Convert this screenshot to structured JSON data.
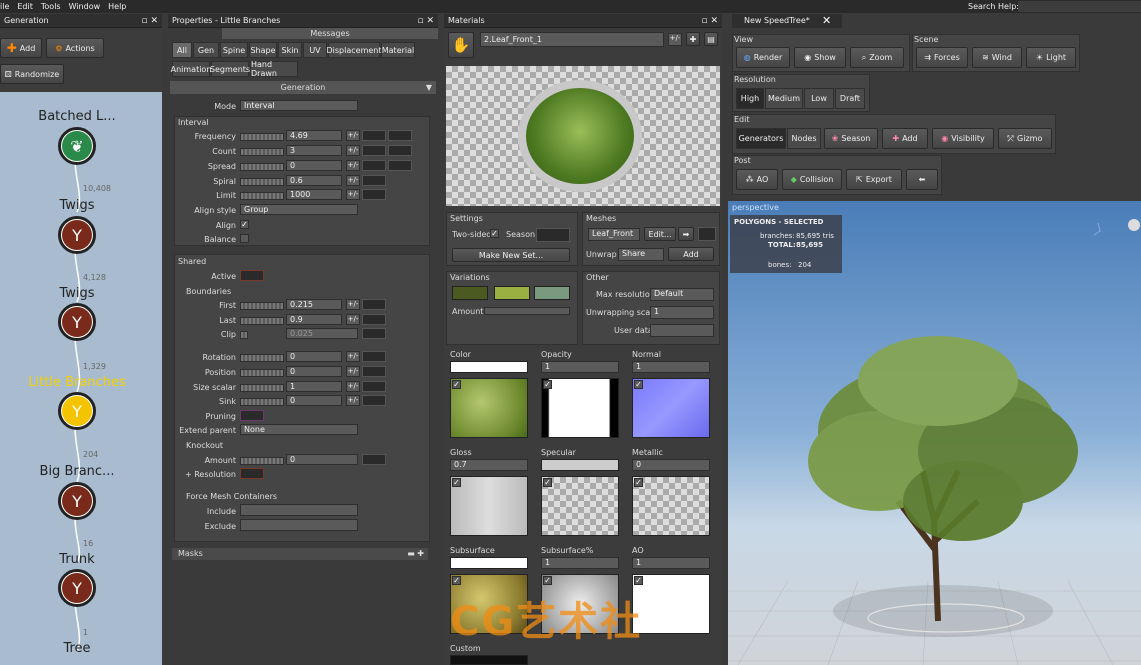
{
  "menu": {
    "items": [
      "ile",
      "Edit",
      "Tools",
      "Window",
      "Help"
    ],
    "search_help": "Search Help:"
  },
  "generation_panel": {
    "title": "Generation",
    "add": "Add",
    "actions": "Actions",
    "randomize": "Randomize",
    "nodes": [
      {
        "label": "Batched L...",
        "count": "10,408"
      },
      {
        "label": "Twigs",
        "count": "4,128"
      },
      {
        "label": "Twigs",
        "count": "1,329"
      },
      {
        "label": "Little Branches",
        "count": "204"
      },
      {
        "label": "Big Branc...",
        "count": "16"
      },
      {
        "label": "Trunk",
        "count": "1"
      },
      {
        "label": "Tree",
        "count": ""
      }
    ],
    "selected_color": "#f5d000"
  },
  "properties": {
    "title": "Properties - Little Branches",
    "messages": "Messages",
    "tabs_row1": [
      "All",
      "Gen",
      "Spine",
      "Shape",
      "Skin",
      "UV",
      "Displacement",
      "Material"
    ],
    "tabs_row2": [
      "Animation",
      "Segments",
      "Hand Drawn"
    ],
    "section": "Generation",
    "mode_label": "Mode",
    "mode_value": "Interval",
    "interval": "Interval",
    "interval_rows": [
      {
        "label": "Frequency",
        "value": "4.69"
      },
      {
        "label": "Count",
        "value": "3"
      },
      {
        "label": "Spread",
        "value": "0"
      },
      {
        "label": "Spiral",
        "value": "0.6"
      },
      {
        "label": "Limit",
        "value": "1000"
      }
    ],
    "align_style_label": "Align style",
    "align_style_value": "Group",
    "align_label": "Align",
    "balance_label": "Balance",
    "shared": "Shared",
    "active_label": "Active",
    "boundaries": "Boundaries",
    "boundary_rows": [
      {
        "label": "First",
        "value": "0.215"
      },
      {
        "label": "Last",
        "value": "0.9"
      },
      {
        "label": "Clip",
        "value": "0.025"
      }
    ],
    "misc_rows": [
      {
        "label": "Rotation",
        "value": "0"
      },
      {
        "label": "Position",
        "value": "0"
      },
      {
        "label": "Size scalar",
        "value": "1"
      },
      {
        "label": "Sink",
        "value": "0"
      }
    ],
    "pruning_label": "Pruning",
    "extend_parent_label": "Extend parent",
    "extend_parent_value": "None",
    "knockout": "Knockout",
    "amount_label": "Amount",
    "amount_value": "0",
    "resolution_label": "+ Resolution",
    "force_mesh": "Force Mesh Containers",
    "include_label": "Include",
    "exclude_label": "Exclude",
    "masks": "Masks"
  },
  "materials": {
    "title": "Materials",
    "material_name": "2.Leaf_Front_1",
    "plus_minus": "+/-",
    "settings": "Settings",
    "two_sided": "Two-sided",
    "season": "Season",
    "make_new_set": "Make New Set...",
    "meshes": "Meshes",
    "mesh_value": "Leaf_Front",
    "edit": "Edit...",
    "unwrap_label": "Unwrap",
    "unwrap_value": "Share",
    "add": "Add",
    "variations": "Variations",
    "amount": "Amount",
    "variation_colors": [
      "#4a5a20",
      "#9ab040",
      "#7a9a80"
    ],
    "other": "Other",
    "max_res_label": "Max resolution",
    "max_res_value": "Default",
    "unwrap_scale_label": "Unwrapping scale",
    "unwrap_scale_value": "1",
    "user_data_label": "User data",
    "maps": [
      {
        "label": "Color",
        "value": ""
      },
      {
        "label": "Opacity",
        "value": "1"
      },
      {
        "label": "Normal",
        "value": "1"
      },
      {
        "label": "Gloss",
        "value": "0.7"
      },
      {
        "label": "Specular",
        "value": ""
      },
      {
        "label": "Metallic",
        "value": "0"
      },
      {
        "label": "Subsurface",
        "value": ""
      },
      {
        "label": "Subsurface%",
        "value": "1"
      },
      {
        "label": "AO",
        "value": "1"
      },
      {
        "label": "Custom",
        "value": ""
      }
    ],
    "watermark": "CG艺术社"
  },
  "viewport": {
    "tab": "New SpeedTree*",
    "close": "✕",
    "view_label": "View",
    "view_buttons": [
      "Render",
      "Show",
      "Zoom"
    ],
    "scene_label": "Scene",
    "scene_buttons": [
      "Forces",
      "Wind",
      "Light"
    ],
    "resolution_label": "Resolution",
    "resolution_buttons": [
      "High",
      "Medium",
      "Low",
      "Draft"
    ],
    "edit_label": "Edit",
    "edit_buttons": [
      "Generators",
      "Nodes",
      "Season",
      "Add",
      "Visibility",
      "Gizmo"
    ],
    "post_label": "Post",
    "post_buttons": [
      "AO",
      "Collision",
      "Export"
    ],
    "perspective": "perspective",
    "stats": {
      "title": "POLYGONS - SELECTED",
      "branches_label": "branches:",
      "branches_value": "85,695 tris",
      "total_label": "TOTAL:",
      "total_value": "85,695",
      "bones_label": "bones:",
      "bones_value": "204"
    }
  }
}
